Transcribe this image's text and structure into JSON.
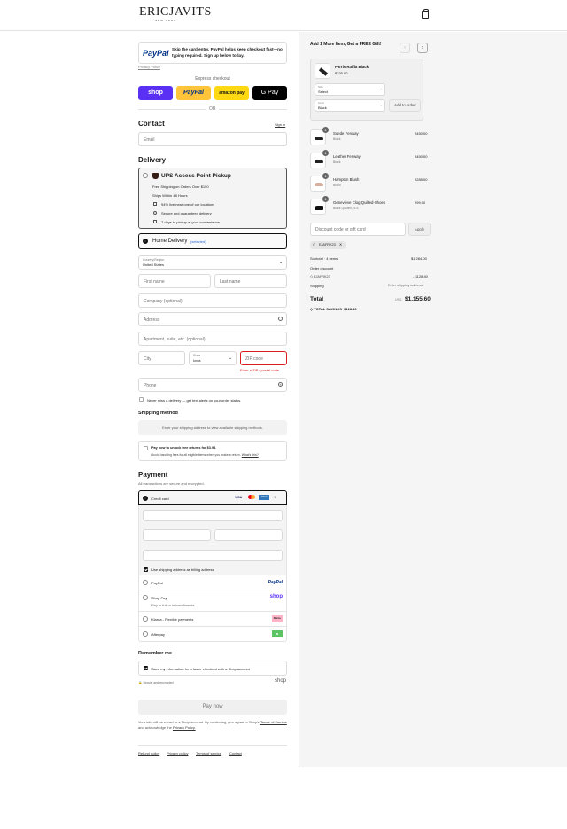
{
  "header": {
    "brand": "ERICJAVITS",
    "brand_sub": "NEW YORK"
  },
  "paypal_banner": {
    "logo": "PayPal",
    "text": "Skip the card entry. PayPal helps keep checkout fast—no typing required. Sign up below today.",
    "privacy": "Privacy Policy"
  },
  "express": {
    "label": "Express checkout",
    "shop": "shop",
    "paypal": "PayPal",
    "amazon": "amazon pay",
    "gpay": "G Pay",
    "or": "OR"
  },
  "contact": {
    "title": "Contact",
    "signin": "Sign in",
    "email_placeholder": "Email"
  },
  "delivery": {
    "title": "Delivery",
    "ups": {
      "title": "UPS Access Point Pickup",
      "line1": "Free Shipping on Orders Over $150",
      "line2": "Ships Within 48 Hours",
      "bullets": [
        "94% live near one of our locations",
        "Secure and guaranteed delivery",
        "7 days to pickup at your convenience"
      ]
    },
    "home": {
      "label": "Home Delivery",
      "selected": "(selected)"
    },
    "country_label": "Country/Region",
    "country": "United States",
    "first_name": "First name",
    "last_name": "Last name",
    "company": "Company (optional)",
    "address": "Address",
    "apartment": "Apartment, suite, etc. (optional)",
    "city": "City",
    "state_label": "State",
    "state": "Iowa",
    "zip": "ZIP code",
    "zip_error": "Enter a ZIP / postal code",
    "phone": "Phone",
    "sms": "Never miss a delivery — get text alerts on your order status."
  },
  "shipping": {
    "title": "Shipping method",
    "message": "Enter your shipping address to view available shipping methods.",
    "returns_title": "Pay now to unlock free returns for $3.98.",
    "returns_sub": "Avoid handling fees for all eligible items when you make a return.",
    "whats_this": "What's this?"
  },
  "payment": {
    "title": "Payment",
    "subtitle": "All transactions are secure and encrypted.",
    "credit_card": "Credit card",
    "cards": [
      "VISA",
      "MC",
      "AMEX",
      "+7"
    ],
    "billing_same": "Use shipping address as billing address",
    "methods": [
      {
        "label": "PayPal",
        "sub": "",
        "logo": "PayPal"
      },
      {
        "label": "Shop Pay",
        "sub": "Pay in full or in installments",
        "logo": "shop"
      },
      {
        "label": "Klarna - Flexible payments",
        "sub": "",
        "logo": "Klarna."
      },
      {
        "label": "Afterpay",
        "sub": "",
        "logo": "a"
      }
    ]
  },
  "remember": {
    "title": "Remember me",
    "save_label": "Save my information for a faster checkout with a Shop account",
    "secure": "Secure and encrypted",
    "shop": "shop"
  },
  "pay": {
    "button": "Pay now",
    "terms1": "Your info will be saved to a Shop account. By continuing, you agree to Shop's",
    "terms_link": "Terms of Service",
    "terms2": "and acknowledge the",
    "privacy_link": "Privacy Policy."
  },
  "footer": {
    "links": [
      "Refund policy",
      "Privacy policy",
      "Terms of service",
      "Contact"
    ]
  },
  "summary": {
    "upsell_title": "Add 1 More Item, Get a FREE Gift!",
    "upsell_item": {
      "name": "Parris Raffia Black",
      "price": "$225.00",
      "size_label": "Size",
      "size": "Select",
      "color_label": "Color",
      "color": "Black",
      "add": "Add to order"
    },
    "items": [
      {
        "qty": "1",
        "name": "Suede Fenway",
        "variant": "Black",
        "price": "$450.00"
      },
      {
        "qty": "1",
        "name": "Leather Fenway",
        "variant": "Black",
        "price": "$450.00"
      },
      {
        "qty": "1",
        "name": "Hampton Blush",
        "variant": "Blush",
        "price": "$285.00"
      },
      {
        "qty": "1",
        "name": "Genevieve Clog Quilted-Shoes",
        "variant": "Black Quilted / 6.5",
        "price": "$99.00"
      }
    ],
    "discount_placeholder": "Discount code or gift card",
    "apply": "Apply",
    "code": "EJAFRK23",
    "subtotal_label": "Subtotal · 4 items",
    "subtotal": "$1,284.00",
    "order_discount": "Order discount",
    "discount_code": "EJAFRK23",
    "discount_amount": "- $128.40",
    "shipping_label": "Shipping",
    "shipping_value": "Enter shipping address",
    "total_label": "Total",
    "currency": "USD",
    "total": "$1,155.60",
    "savings_label": "TOTAL SAVINGS",
    "savings": "$128.40"
  }
}
